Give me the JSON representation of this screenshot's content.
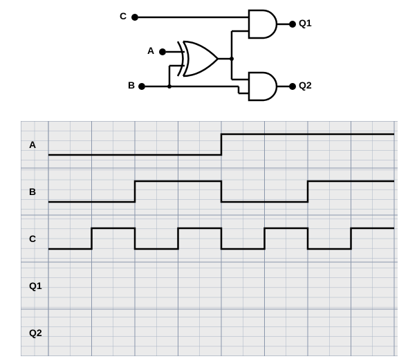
{
  "circuit": {
    "inputs": [
      "C",
      "A",
      "B"
    ],
    "outputs": [
      "Q1",
      "Q2"
    ],
    "gates": [
      {
        "type": "XOR",
        "inputs": [
          "A",
          "B"
        ],
        "output": "X"
      },
      {
        "type": "AND",
        "inputs": [
          "C",
          "X"
        ],
        "output": "Q1"
      },
      {
        "type": "AND",
        "inputs": [
          "X",
          "B"
        ],
        "output": "Q2"
      }
    ]
  },
  "signals": {
    "labels": [
      "A",
      "B",
      "C",
      "Q1",
      "Q2"
    ],
    "time_divisions": 8,
    "A": [
      0,
      0,
      0,
      0,
      1,
      1,
      1,
      1
    ],
    "B": [
      0,
      0,
      1,
      1,
      0,
      0,
      1,
      1
    ],
    "C": [
      0,
      1,
      0,
      1,
      0,
      1,
      0,
      1
    ],
    "Q1": [
      null,
      null,
      null,
      null,
      null,
      null,
      null,
      null
    ],
    "Q2": [
      null,
      null,
      null,
      null,
      null,
      null,
      null,
      null
    ]
  },
  "labels": {
    "C": "C",
    "A": "A",
    "B": "B",
    "Q1": "Q1",
    "Q2": "Q2"
  }
}
